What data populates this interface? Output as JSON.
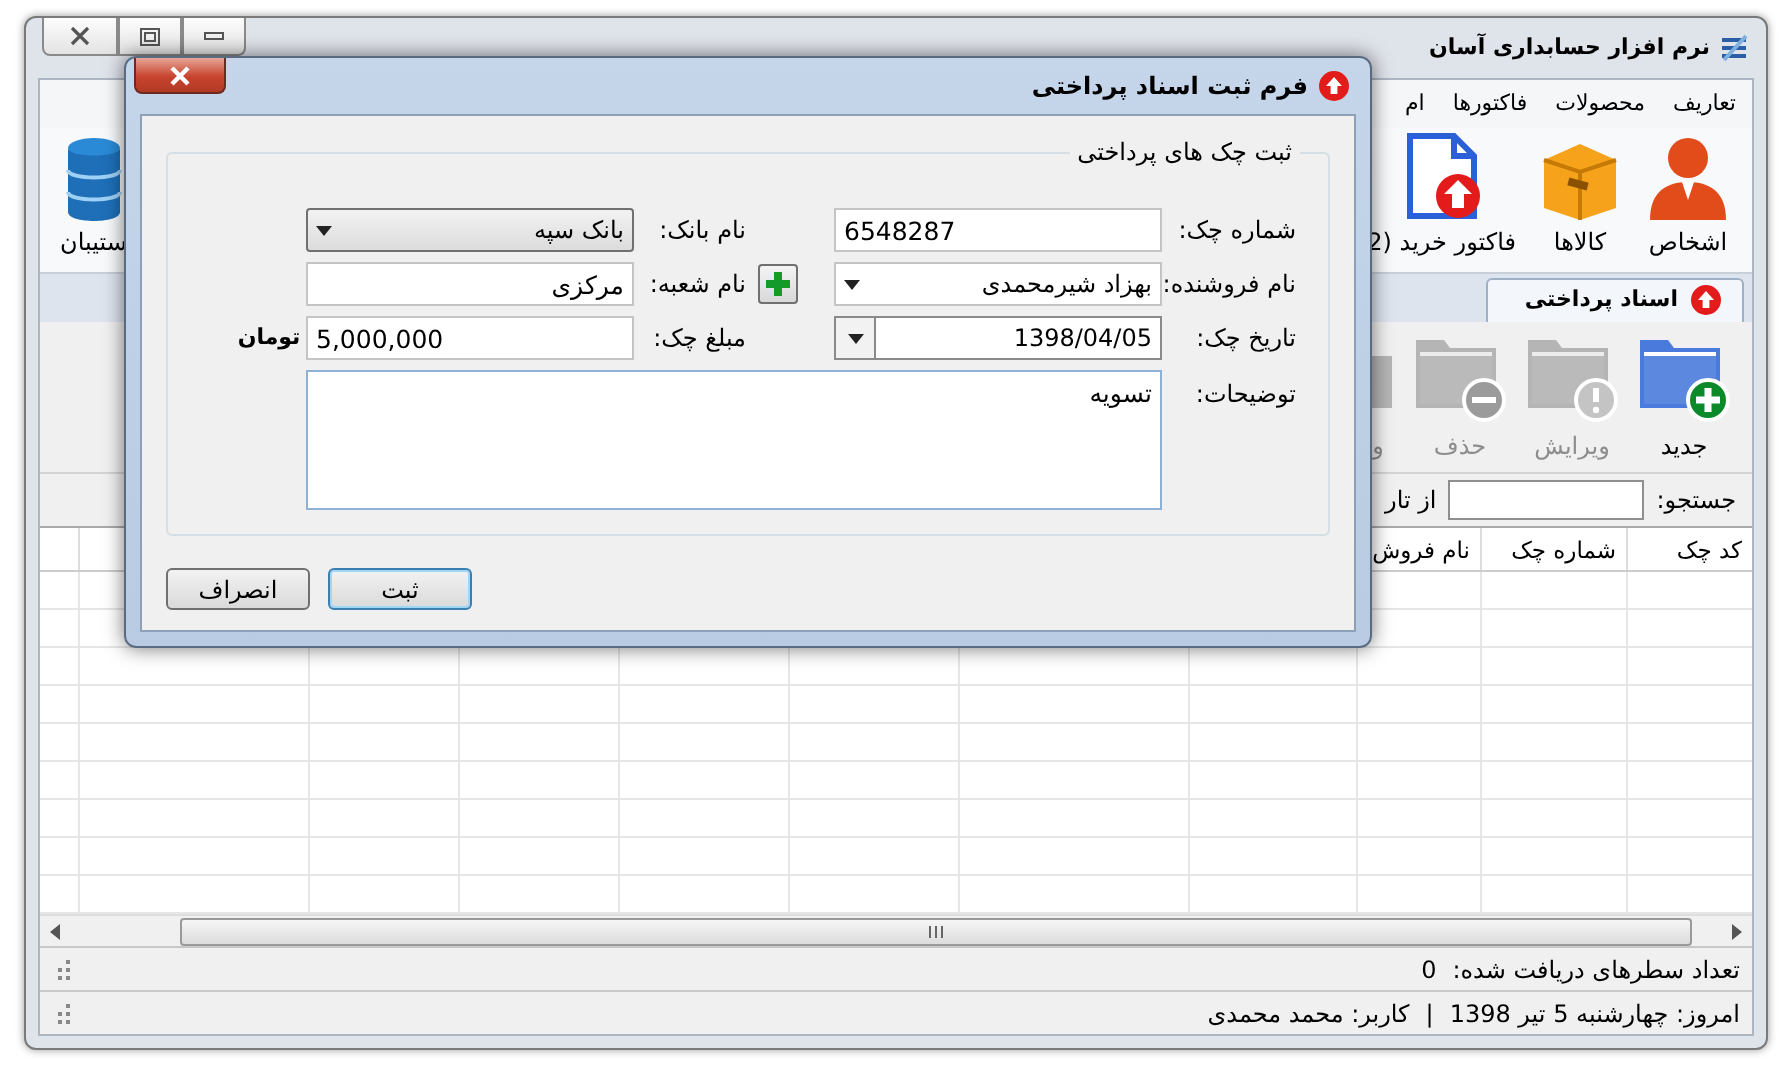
{
  "window": {
    "title": "نرم افزار حسابداری آسان"
  },
  "menu": [
    "تعاریف",
    "محصولات",
    "فاکتورها",
    "ام"
  ],
  "ribbon": [
    {
      "label": "اشخاص",
      "kind": "person"
    },
    {
      "label": "کالاها",
      "kind": "box"
    },
    {
      "label": "فاکتور خرید (2",
      "kind": "invoice"
    }
  ],
  "ribbon_left": {
    "label": "ستیبان",
    "kind": "database"
  },
  "tab": {
    "label": "اسناد پرداختی",
    "selected": true
  },
  "toolbar": [
    {
      "label": "جدید",
      "kind": "add",
      "disabled": false
    },
    {
      "label": "ویرایش",
      "kind": "edit",
      "disabled": true
    },
    {
      "label": "حذف",
      "kind": "delete",
      "disabled": true
    },
    {
      "label": "و",
      "kind": "partial",
      "disabled": true
    }
  ],
  "search": {
    "label": "جستجو:",
    "from_label": "از تار"
  },
  "table": {
    "columns": [
      "کد چک",
      "شماره چک",
      "نام فروش"
    ]
  },
  "status": {
    "count_label": "تعداد سطرهای دریافت شده:",
    "count": "0"
  },
  "footer": {
    "date": "امروز: چهارشنبه 5 تیر 1398",
    "separator": "|",
    "user": "کاربر: محمد محمدی"
  },
  "dialog": {
    "title": "فرم ثبت اسناد پرداختی",
    "group": "ثبت چک های پرداختی",
    "rows": [
      [
        {
          "label": "شماره چک:",
          "kind": "text",
          "value": "6548287"
        },
        {
          "label": "نام بانک:",
          "kind": "button_combo",
          "value": "بانک سپه"
        }
      ],
      [
        {
          "label": "نام فروشنده:",
          "kind": "combo",
          "value": "بهزاد شیرمحمدی",
          "add_button": true
        },
        {
          "label": "نام شعبه:",
          "kind": "text",
          "value": "مرکزی"
        }
      ],
      [
        {
          "label": "تاریخ چک:",
          "kind": "date",
          "value": "1398/04/05"
        },
        {
          "label": "مبلغ چک:",
          "kind": "text",
          "value": "5,000,000",
          "unit": "تومان"
        }
      ]
    ],
    "notes": {
      "label": "توضیحات:",
      "kind": "textarea",
      "value": "تسویه"
    },
    "buttons": [
      {
        "label": "ثبت",
        "default": true
      },
      {
        "label": "انصراف",
        "default": false
      }
    ]
  }
}
